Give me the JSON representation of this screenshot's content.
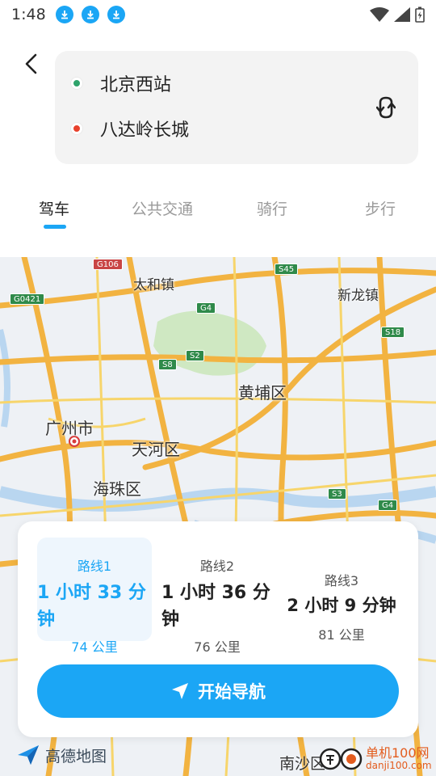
{
  "status_bar": {
    "time": "1:48",
    "download_icons": [
      "download-icon",
      "download-icon",
      "download-icon"
    ],
    "right_icons": [
      "wifi-icon",
      "signal-icon",
      "battery-charging-icon"
    ]
  },
  "route": {
    "start": "北京西站",
    "end": "八达岭长城",
    "start_color": "#2ea36b",
    "end_color": "#e8412c"
  },
  "tabs": [
    {
      "label": "驾车",
      "active": true
    },
    {
      "label": "公共交通",
      "active": false
    },
    {
      "label": "骑行",
      "active": false
    },
    {
      "label": "步行",
      "active": false
    }
  ],
  "map": {
    "labels": [
      "太和镇",
      "新龙镇",
      "黄埔区",
      "广州市",
      "天河区",
      "海珠区",
      "南沙区"
    ],
    "road_badges": [
      "G106",
      "G0421",
      "S45",
      "G4",
      "S18",
      "S2",
      "S8",
      "S3",
      "G4"
    ]
  },
  "routes": [
    {
      "label": "路线1",
      "time": "1 小时 33 分钟",
      "distance": "74 公里",
      "selected": true
    },
    {
      "label": "路线2",
      "time": "1 小时 36 分钟",
      "distance": "76 公里",
      "selected": false
    },
    {
      "label": "路线3",
      "time": "2 小时 9 分钟",
      "distance": "81 公里",
      "selected": false
    }
  ],
  "navigate_button": "开始导航",
  "watermark": {
    "map_brand": "高德地图",
    "site_name": "单机100网",
    "site_url": "danji100.com"
  },
  "colors": {
    "accent": "#1ba6f5",
    "selected_bg": "#eef6fd"
  }
}
